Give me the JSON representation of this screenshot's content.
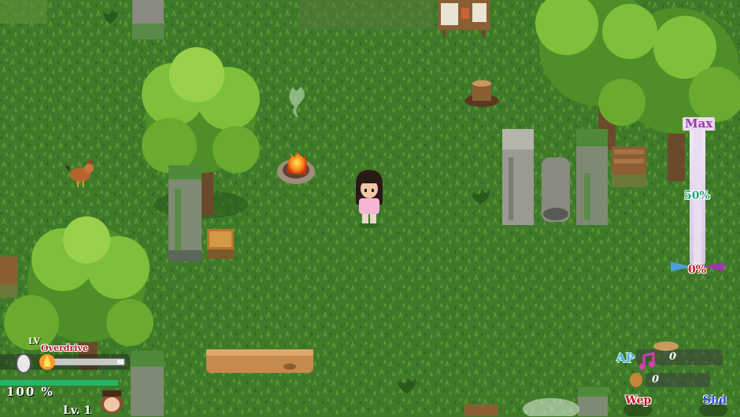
{
  "hud": {
    "gauge": {
      "max_label": "Max",
      "mid_label": "50%",
      "min_label": "0%",
      "level_fraction": 0.0
    },
    "player": {
      "lv_label": "LV",
      "overdrive_label": "Overdrive",
      "hp_percent_text": "100 %",
      "level_text": "Lv. 1",
      "overdrive_fraction": 0.9
    },
    "resources": {
      "ap_label": "AP",
      "ap_value": "0",
      "item_value": "0",
      "weapon_label": "Wep",
      "shield_label": "Shd"
    }
  },
  "colors": {
    "grass": "#3f7a2a",
    "grass_light": "#5a9a33",
    "foliage": "#7fc03a",
    "trunk": "#6b4a2b",
    "stone": "#8a8a82",
    "moss": "#4f8a3a",
    "gauge_fill": "#9a3aa8",
    "hp_bar": "#26b66a",
    "text_red": "#c0182a",
    "text_teal": "#1aa87a"
  }
}
